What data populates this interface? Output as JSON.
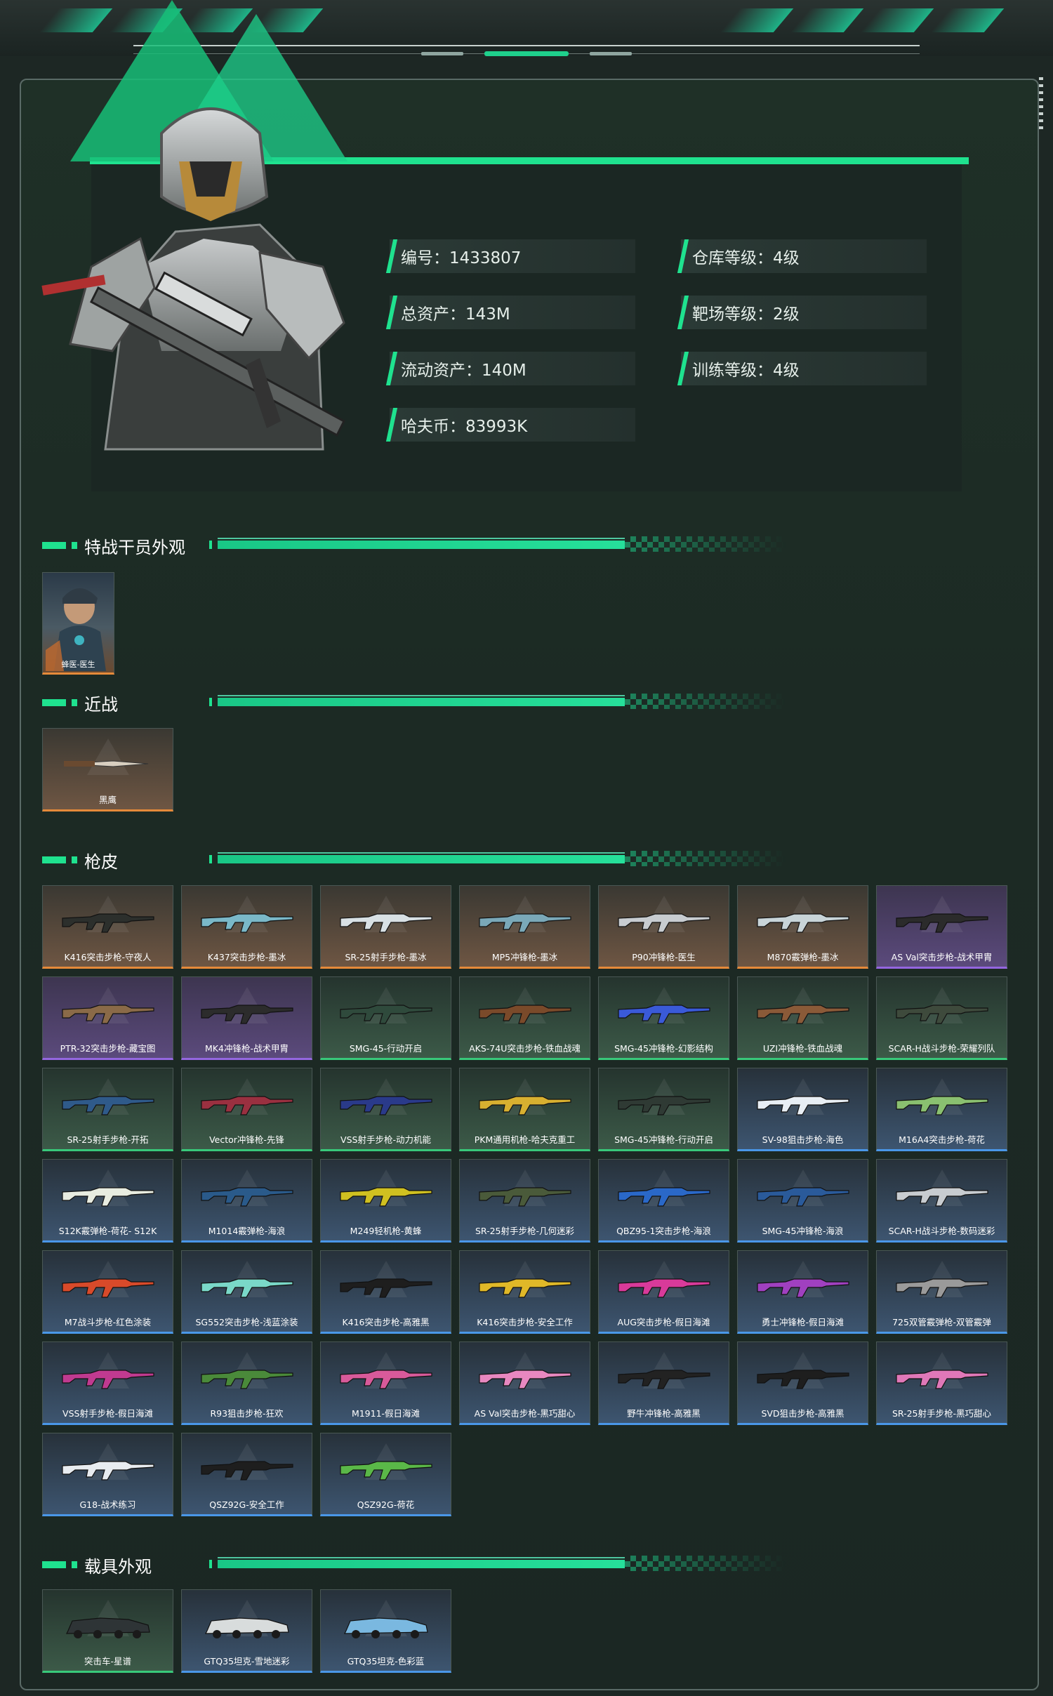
{
  "profile": {
    "id_label": "编号：1433807",
    "total_assets": "总资产：143M",
    "liquid_assets": "流动资产：140M",
    "hafu_coins": "哈夫币：83993K",
    "warehouse_level": "仓库等级：4级",
    "range_level": "靶场等级：2级",
    "training_level": "训练等级：4级"
  },
  "sections": {
    "operator": "特战干员外观",
    "melee": "近战",
    "gun_skins": "枪皮",
    "vehicle": "载具外观"
  },
  "operator_items": [
    {
      "name": "蜂医-医生",
      "rarity": "orange"
    }
  ],
  "melee_items": [
    {
      "name": "黑鹰",
      "rarity": "orange"
    }
  ],
  "gun_items": [
    {
      "name": "K416突击步枪-守夜人",
      "rarity": "orange"
    },
    {
      "name": "K437突击步枪-墨冰",
      "rarity": "orange"
    },
    {
      "name": "SR-25射手步枪-墨冰",
      "rarity": "orange"
    },
    {
      "name": "MP5冲锋枪-墨冰",
      "rarity": "orange"
    },
    {
      "name": "P90冲锋枪-医生",
      "rarity": "orange"
    },
    {
      "name": "M870霰弹枪-墨冰",
      "rarity": "orange"
    },
    {
      "name": "AS Val突击步枪-战术甲胄",
      "rarity": "purple"
    },
    {
      "name": "PTR-32突击步枪-藏宝图",
      "rarity": "purple"
    },
    {
      "name": "MK4冲锋枪-战术甲胄",
      "rarity": "purple"
    },
    {
      "name": "SMG-45-行动开启",
      "rarity": "green"
    },
    {
      "name": "AKS-74U突击步枪-铁血战魂",
      "rarity": "green"
    },
    {
      "name": "SMG-45冲锋枪-幻影结构",
      "rarity": "green"
    },
    {
      "name": "UZI冲锋枪-铁血战魂",
      "rarity": "green"
    },
    {
      "name": "SCAR-H战斗步枪-荣耀列队",
      "rarity": "green"
    },
    {
      "name": "SR-25射手步枪-开拓",
      "rarity": "green"
    },
    {
      "name": "Vector冲锋枪-先锋",
      "rarity": "green"
    },
    {
      "name": "VSS射手步枪-动力机能",
      "rarity": "green"
    },
    {
      "name": "PKM通用机枪-哈夫克重工",
      "rarity": "green"
    },
    {
      "name": "SMG-45冲锋枪-行动开启",
      "rarity": "green"
    },
    {
      "name": "SV-98狙击步枪-海色",
      "rarity": "blue"
    },
    {
      "name": "M16A4突击步枪-荷花",
      "rarity": "blue"
    },
    {
      "name": "S12K霰弹枪-荷花- S12K",
      "rarity": "blue"
    },
    {
      "name": "M1014霰弹枪-海浪",
      "rarity": "blue"
    },
    {
      "name": "M249轻机枪-黄蜂",
      "rarity": "blue"
    },
    {
      "name": "SR-25射手步枪-几何迷彩",
      "rarity": "blue"
    },
    {
      "name": "QBZ95-1突击步枪-海浪",
      "rarity": "blue"
    },
    {
      "name": "SMG-45冲锋枪-海浪",
      "rarity": "blue"
    },
    {
      "name": "SCAR-H战斗步枪-数码迷彩",
      "rarity": "blue"
    },
    {
      "name": "M7战斗步枪-红色涂装",
      "rarity": "blue"
    },
    {
      "name": "SG552突击步枪-浅蓝涂装",
      "rarity": "blue"
    },
    {
      "name": "K416突击步枪-高雅黑",
      "rarity": "blue"
    },
    {
      "name": "K416突击步枪-安全工作",
      "rarity": "blue"
    },
    {
      "name": "AUG突击步枪-假日海滩",
      "rarity": "blue"
    },
    {
      "name": "勇士冲锋枪-假日海滩",
      "rarity": "blue"
    },
    {
      "name": "725双管霰弹枪-双管霰弹",
      "rarity": "blue"
    },
    {
      "name": "VSS射手步枪-假日海滩",
      "rarity": "blue"
    },
    {
      "name": "R93狙击步枪-狂欢",
      "rarity": "blue"
    },
    {
      "name": "M1911-假日海滩",
      "rarity": "blue"
    },
    {
      "name": "AS Val突击步枪-黑巧甜心",
      "rarity": "blue"
    },
    {
      "name": "野牛冲锋枪-高雅黑",
      "rarity": "blue"
    },
    {
      "name": "SVD狙击步枪-高雅黑",
      "rarity": "blue"
    },
    {
      "name": "SR-25射手步枪-黑巧甜心",
      "rarity": "blue"
    },
    {
      "name": "G18-战术练习",
      "rarity": "blue"
    },
    {
      "name": "QSZ92G-安全工作",
      "rarity": "blue"
    },
    {
      "name": "QSZ92G-荷花",
      "rarity": "blue"
    }
  ],
  "vehicle_items": [
    {
      "name": "突击车-星谱",
      "rarity": "green"
    },
    {
      "name": "GTQ35坦克-雪地迷彩",
      "rarity": "blue"
    },
    {
      "name": "GTQ35坦克-色彩蓝",
      "rarity": "blue"
    }
  ],
  "colors": {
    "accent": "#1fe28f",
    "orange_rarity": "#e58a3a",
    "purple_rarity": "#9466e0",
    "green_rarity": "#38c97a",
    "blue_rarity": "#4a97e8"
  },
  "gun_colors": [
    "#2c2f2c",
    "#7ab8c8",
    "#d8e0e4",
    "#7aa8b8",
    "#c8ccd0",
    "#c8d4d8",
    "#2b2b2b",
    "#8a6a48",
    "#2c2c2c",
    "#2f4a3c",
    "#7a4a2a",
    "#3a5ad8",
    "#8a5a38",
    "#3e4a3c",
    "#2f5a8a",
    "#9a3040",
    "#2a3a8a",
    "#d8b030",
    "#2f3a34",
    "#e8eef4",
    "#8ac070",
    "#e8ece0",
    "#2a5a8a",
    "#d0c020",
    "#4a5a3a",
    "#2a68c8",
    "#2a5a9a",
    "#c8ccd0",
    "#d84a2a",
    "#7ad8c8",
    "#1e1e1e",
    "#e0b828",
    "#d83a9a",
    "#a040c0",
    "#9a9a9a",
    "#c03a90",
    "#4a8a3a",
    "#d85a9a",
    "#e888c0",
    "#222222",
    "#1e1e1e",
    "#e078b8",
    "#e8ecf0",
    "#1e1e1e",
    "#5ab848"
  ]
}
